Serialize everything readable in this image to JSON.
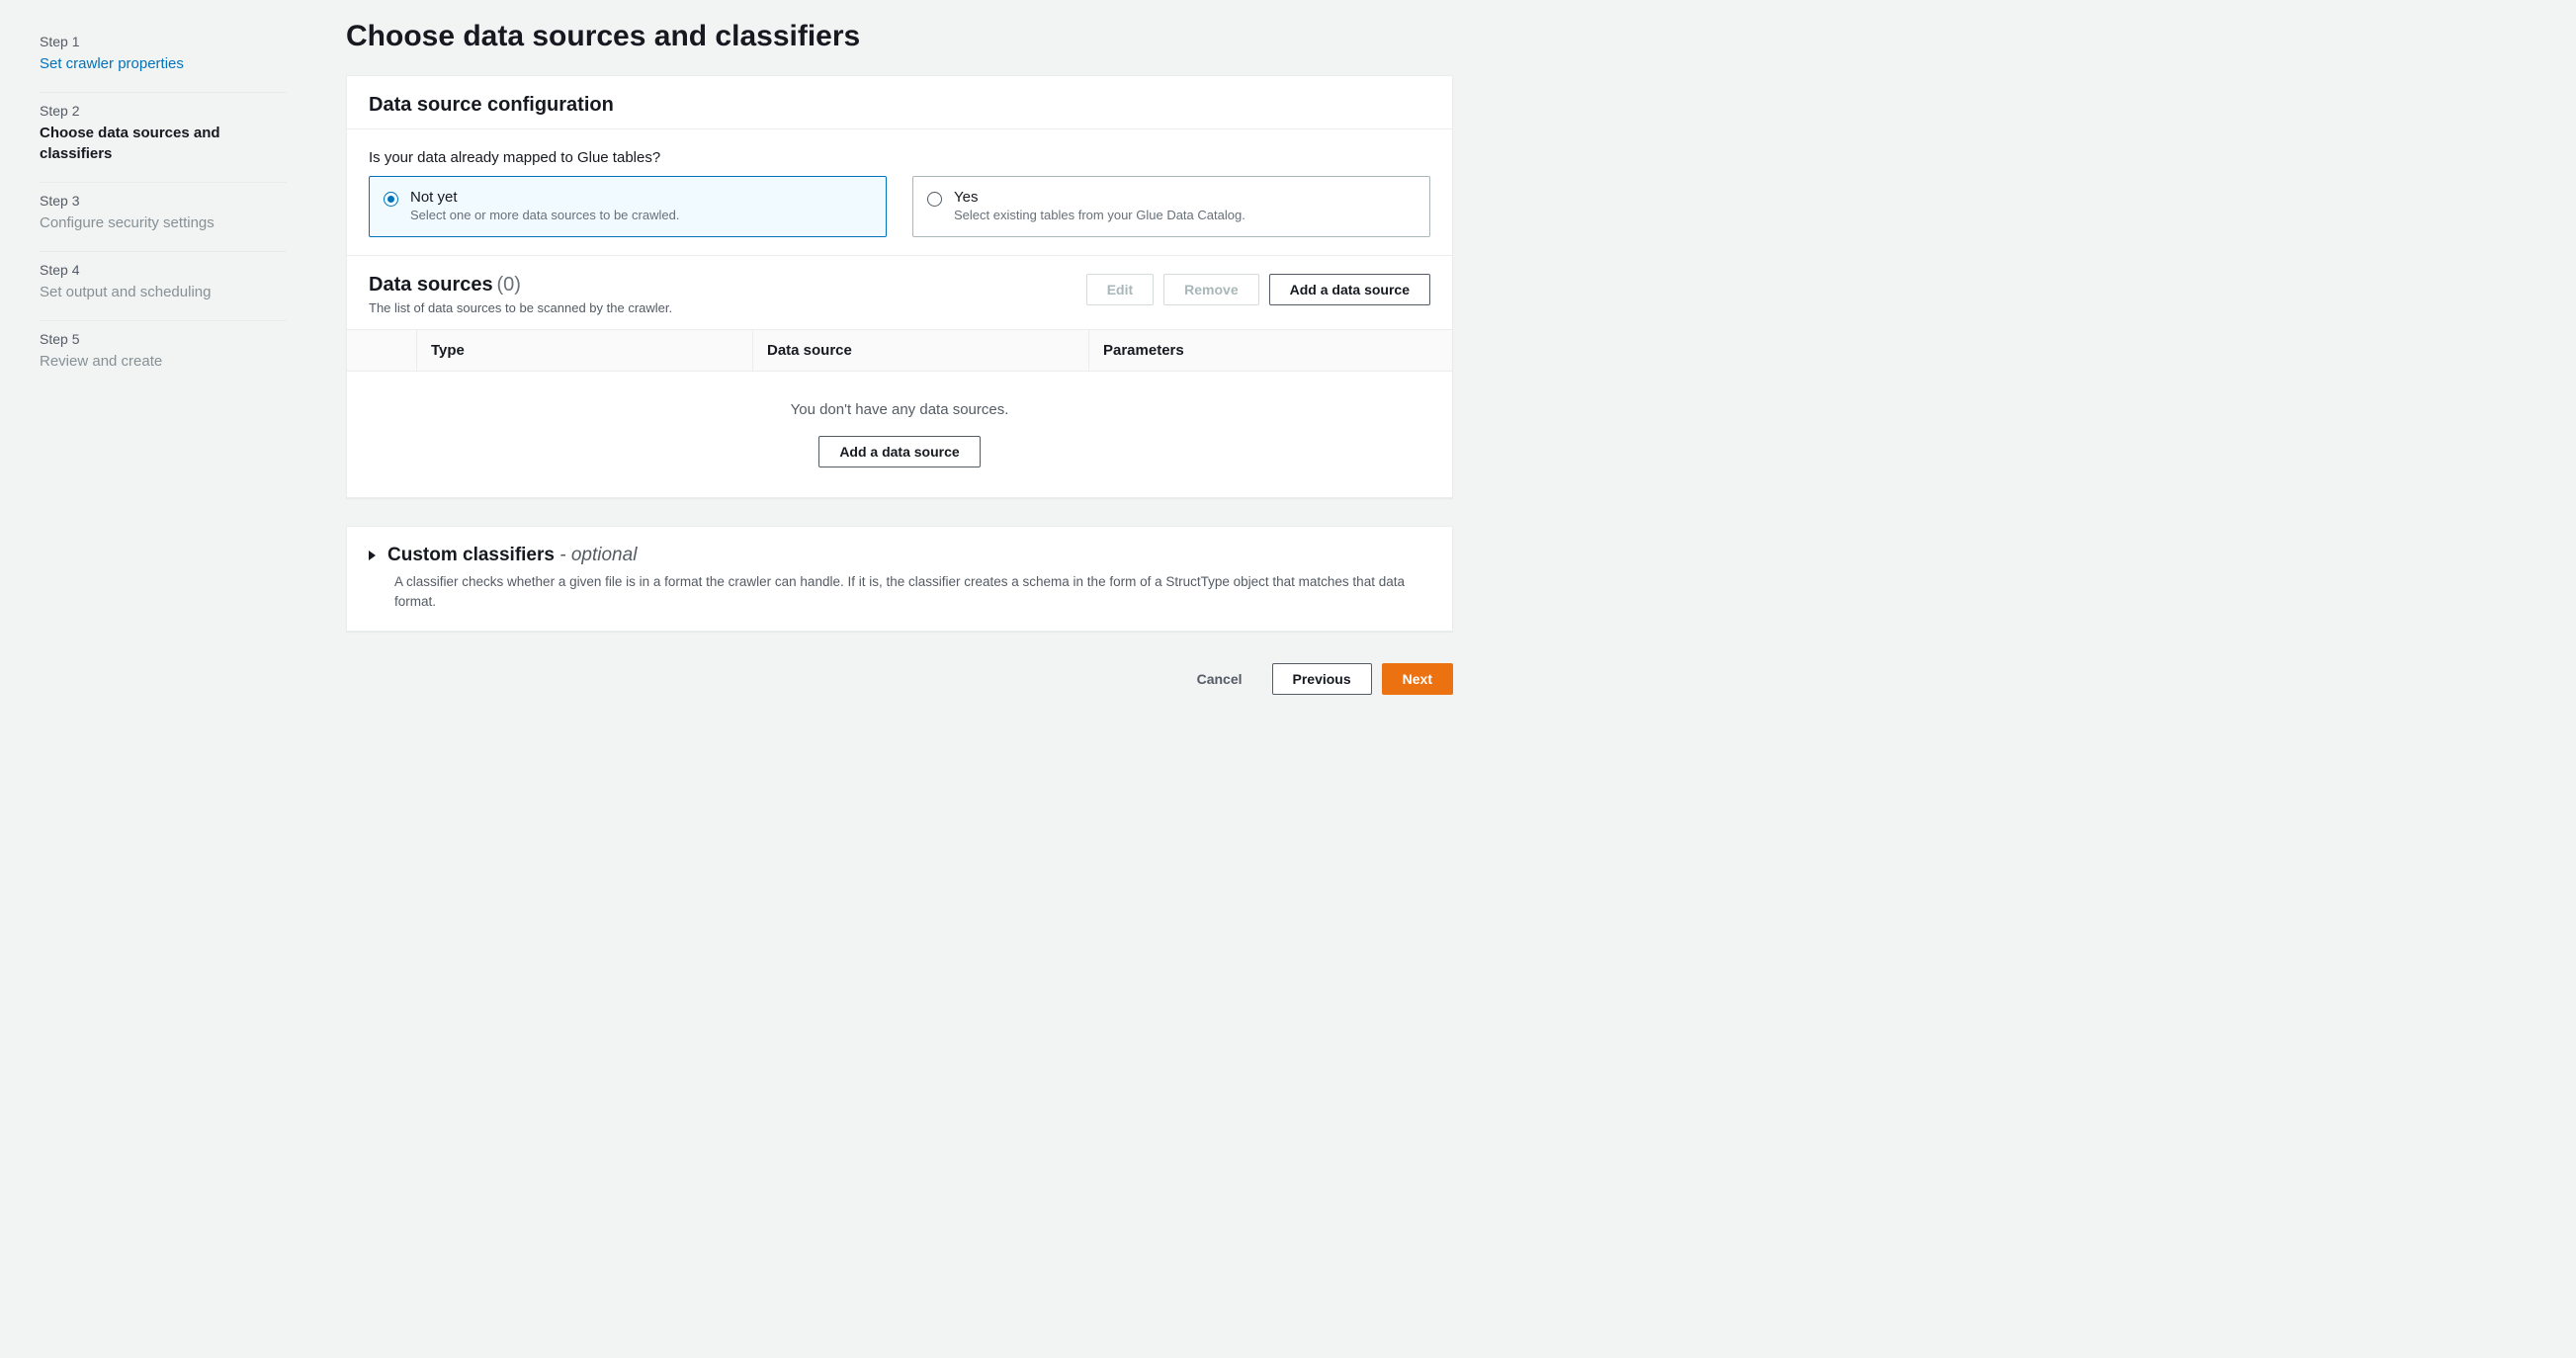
{
  "sidebar": {
    "steps": [
      {
        "num": "Step 1",
        "title": "Set crawler properties",
        "state": "completed"
      },
      {
        "num": "Step 2",
        "title": "Choose data sources and classifiers",
        "state": "active"
      },
      {
        "num": "Step 3",
        "title": "Configure security settings",
        "state": "pending"
      },
      {
        "num": "Step 4",
        "title": "Set output and scheduling",
        "state": "pending"
      },
      {
        "num": "Step 5",
        "title": "Review and create",
        "state": "pending"
      }
    ]
  },
  "page": {
    "title": "Choose data sources and classifiers"
  },
  "config": {
    "heading": "Data source configuration",
    "question": "Is your data already mapped to Glue tables?",
    "options": {
      "notyet": {
        "label": "Not yet",
        "desc": "Select one or more data sources to be crawled."
      },
      "yes": {
        "label": "Yes",
        "desc": "Select existing tables from your Glue Data Catalog."
      }
    }
  },
  "sources": {
    "heading": "Data sources",
    "count": "(0)",
    "desc": "The list of data sources to be scanned by the crawler.",
    "buttons": {
      "edit": "Edit",
      "remove": "Remove",
      "add": "Add a data source"
    },
    "columns": {
      "type": "Type",
      "source": "Data source",
      "params": "Parameters"
    },
    "empty_text": "You don't have any data sources.",
    "empty_add": "Add a data source"
  },
  "classifiers": {
    "title": "Custom classifiers",
    "sep": " - ",
    "optional": "optional",
    "desc": "A classifier checks whether a given file is in a format the crawler can handle. If it is, the classifier creates a schema in the form of a StructType object that matches that data format."
  },
  "footer": {
    "cancel": "Cancel",
    "previous": "Previous",
    "next": "Next"
  }
}
